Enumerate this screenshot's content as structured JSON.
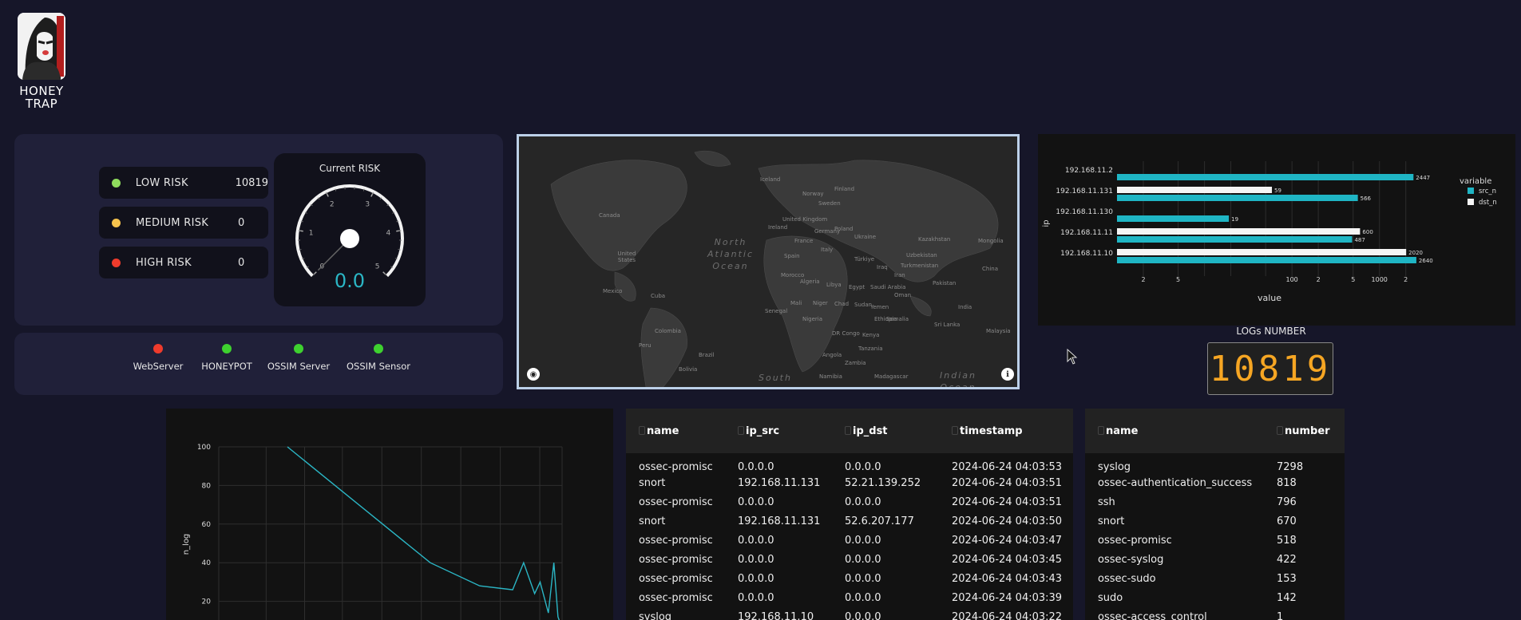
{
  "logo": {
    "line1": "HONEY",
    "line2": "TRAP"
  },
  "risk": {
    "items": [
      {
        "label": "LOW RISK",
        "value": "10819",
        "color": "#8fdc5d"
      },
      {
        "label": "MEDIUM RISK",
        "value": "0",
        "color": "#f6c34d"
      },
      {
        "label": "HIGH RISK",
        "value": "0",
        "color": "#ef3b2c"
      }
    ],
    "gauge": {
      "title": "Current RISK",
      "value": "0.0",
      "ticks": [
        "0",
        "1",
        "2",
        "3",
        "4",
        "5"
      ],
      "level": 0.0,
      "max": 5
    }
  },
  "status": [
    {
      "label": "WebServer",
      "color": "#ef3b2c"
    },
    {
      "label": "HONEYPOT",
      "color": "#3ed12f"
    },
    {
      "label": "OSSIM Server",
      "color": "#3ed12f"
    },
    {
      "label": "OSSIM Sensor",
      "color": "#3ed12f"
    }
  ],
  "map": {
    "labels": [
      "Iceland",
      "Canada",
      "United States",
      "Mexico",
      "Cuba",
      "Colombia",
      "Peru",
      "Brazil",
      "Bolivia",
      "Norway",
      "Sweden",
      "Finland",
      "United Kingdom",
      "Ireland",
      "France",
      "Spain",
      "Germany",
      "Poland",
      "Ukraine",
      "Italy",
      "Türkiye",
      "Morocco",
      "Algeria",
      "Libya",
      "Egypt",
      "Mali",
      "Niger",
      "Chad",
      "Sudan",
      "Nigeria",
      "Ethiopia",
      "DR Congo",
      "Angola",
      "Tanzania",
      "Namibia",
      "Madagascar",
      "Senegal",
      "Iraq",
      "Iran",
      "Saudi Arabia",
      "Kazakhstan",
      "Mongolia",
      "China",
      "India",
      "Pakistan",
      "Uzbekistan",
      "Sri Lanka",
      "Malaysia",
      "Turkmenistan",
      "Yemen",
      "Oman",
      "Somalia",
      "Kenya",
      "Zambia"
    ],
    "oceans": [
      "North Atlantic Ocean",
      "South",
      "Indian Ocean"
    ]
  },
  "bar_chart": {
    "ylabel": "ip",
    "xlabel": "value",
    "legend_title": "variable",
    "legend_position": "right",
    "x_scale": "log",
    "categories": [
      "192.168.11.2",
      "192.168.11.131",
      "192.168.11.130",
      "192.168.11.11",
      "192.168.11.10"
    ],
    "series": [
      {
        "name": "src_n",
        "color": "#1fb5c4",
        "values": [
          2447,
          566,
          19,
          487,
          2640
        ]
      },
      {
        "name": "dst_n",
        "color": "#f5f5f5",
        "values": [
          null,
          59,
          null,
          600,
          2020
        ]
      }
    ],
    "xticks": [
      "2",
      "5",
      "100",
      "2",
      "5",
      "1000",
      "2"
    ]
  },
  "logs_counter": {
    "label": "LOGs NUMBER",
    "value": "10819"
  },
  "chart_data": {
    "type": "line",
    "xlabel": "",
    "ylabel": "n_log",
    "ylim": [
      0,
      100
    ],
    "yticks": [
      "20",
      "40",
      "60",
      "80",
      "100"
    ],
    "grid": true,
    "series": [
      {
        "color": "#2bb6c5",
        "x": [
          0,
          0.52,
          0.7,
          0.82,
          0.86,
          0.9,
          0.92,
          0.95,
          0.97,
          0.985,
          1.0
        ],
        "values": [
          100,
          40,
          28,
          26,
          40,
          24,
          30,
          14,
          40,
          12,
          6
        ]
      }
    ]
  },
  "log_table": {
    "columns": [
      "name",
      "ip_src",
      "ip_dst",
      "timestamp"
    ],
    "rows": [
      [
        "ossec-promisc",
        "0.0.0.0",
        "0.0.0.0",
        "2024-06-24 04:03:53"
      ],
      [
        "snort",
        "192.168.11.131",
        "52.21.139.252",
        "2024-06-24 04:03:51"
      ],
      [
        "ossec-promisc",
        "0.0.0.0",
        "0.0.0.0",
        "2024-06-24 04:03:51"
      ],
      [
        "snort",
        "192.168.11.131",
        "52.6.207.177",
        "2024-06-24 04:03:50"
      ],
      [
        "ossec-promisc",
        "0.0.0.0",
        "0.0.0.0",
        "2024-06-24 04:03:47"
      ],
      [
        "ossec-promisc",
        "0.0.0.0",
        "0.0.0.0",
        "2024-06-24 04:03:45"
      ],
      [
        "ossec-promisc",
        "0.0.0.0",
        "0.0.0.0",
        "2024-06-24 04:03:43"
      ],
      [
        "ossec-promisc",
        "0.0.0.0",
        "0.0.0.0",
        "2024-06-24 04:03:39"
      ],
      [
        "syslog",
        "192.168.11.10",
        "0.0.0.0",
        "2024-06-24 04:03:22"
      ]
    ]
  },
  "stat_table": {
    "columns": [
      "name",
      "number"
    ],
    "rows": [
      [
        "syslog",
        "7298"
      ],
      [
        "ossec-authentication_success",
        "818"
      ],
      [
        "ssh",
        "796"
      ],
      [
        "snort",
        "670"
      ],
      [
        "ossec-promisc",
        "518"
      ],
      [
        "ossec-syslog",
        "422"
      ],
      [
        "ossec-sudo",
        "153"
      ],
      [
        "sudo",
        "142"
      ],
      [
        "ossec-access_control",
        "1"
      ]
    ]
  }
}
